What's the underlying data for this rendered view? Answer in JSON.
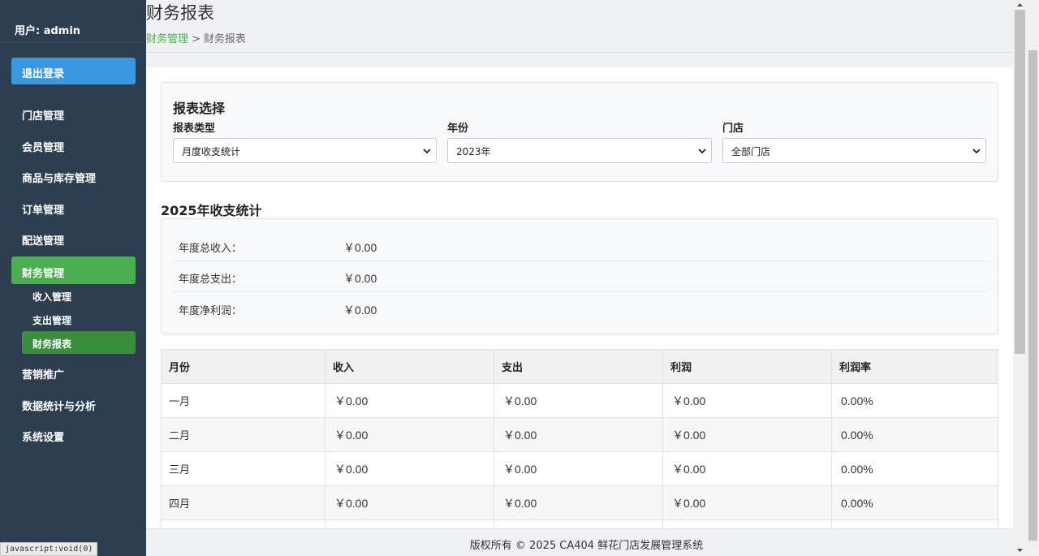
{
  "sidebar": {
    "user": "用户: admin",
    "logout": "退出登录",
    "items": [
      {
        "label": "门店管理"
      },
      {
        "label": "会员管理"
      },
      {
        "label": "商品与库存管理"
      },
      {
        "label": "订单管理"
      },
      {
        "label": "配送管理"
      },
      {
        "label": "财务管理",
        "active": true
      },
      {
        "label": "营销推广"
      },
      {
        "label": "数据统计与分析"
      },
      {
        "label": "系统设置"
      }
    ],
    "sub_items": [
      {
        "label": "收入管理"
      },
      {
        "label": "支出管理"
      },
      {
        "label": "财务报表",
        "active": true
      }
    ]
  },
  "header": {
    "title": "财务报表",
    "breadcrumb_link": "财务管理",
    "breadcrumb_sep": ">",
    "breadcrumb_current": "财务报表"
  },
  "selector": {
    "title": "报表选择",
    "type_label": "报表类型",
    "type_value": "月度收支统计",
    "year_label": "年份",
    "year_value": "2023年",
    "store_label": "门店",
    "store_value": "全部门店"
  },
  "summary": {
    "title": "2025年收支统计",
    "rows": [
      {
        "label": "年度总收入：",
        "value": "￥0.00"
      },
      {
        "label": "年度总支出：",
        "value": "￥0.00"
      },
      {
        "label": "年度净利润：",
        "value": "￥0.00"
      }
    ]
  },
  "table": {
    "headers": [
      "月份",
      "收入",
      "支出",
      "利润",
      "利润率"
    ],
    "rows": [
      [
        "一月",
        "￥0.00",
        "￥0.00",
        "￥0.00",
        "0.00%"
      ],
      [
        "二月",
        "￥0.00",
        "￥0.00",
        "￥0.00",
        "0.00%"
      ],
      [
        "三月",
        "￥0.00",
        "￥0.00",
        "￥0.00",
        "0.00%"
      ],
      [
        "四月",
        "￥0.00",
        "￥0.00",
        "￥0.00",
        "0.00%"
      ]
    ]
  },
  "footer": {
    "text": "版权所有 © 2025 CA404 鲜花门店发展管理系统"
  },
  "statusbar": {
    "text": "javascript:void(0)"
  },
  "colors": {
    "sidebar_bg": "#2c3e50",
    "logout_bg": "#3a97e0",
    "active_bg": "#4cae50",
    "sub_active_bg": "#3a8e3e",
    "link": "#4cae50"
  }
}
